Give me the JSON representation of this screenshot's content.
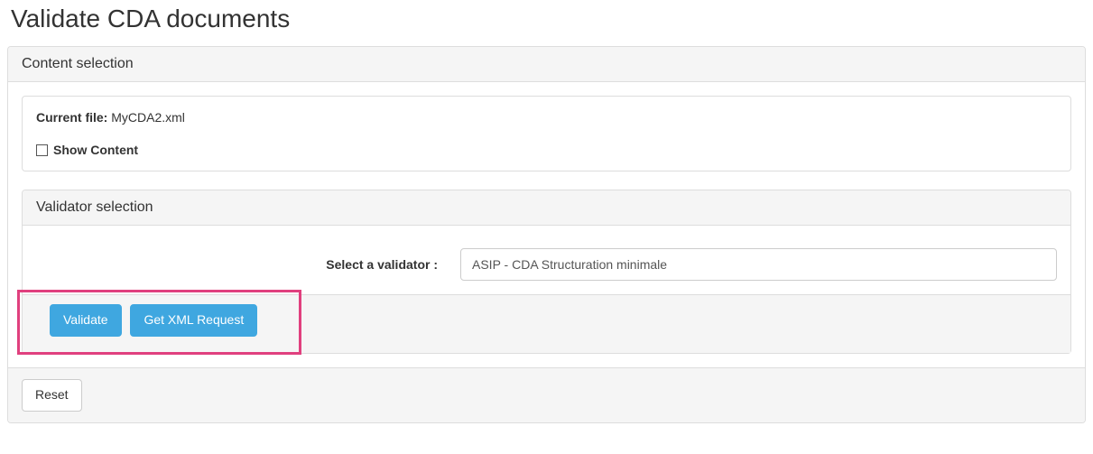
{
  "page": {
    "title": "Validate CDA documents"
  },
  "content_selection": {
    "heading": "Content selection",
    "current_file_label": "Current file:",
    "current_file_value": "MyCDA2.xml",
    "show_content_label": "Show Content",
    "show_content_checked": false
  },
  "validator_selection": {
    "heading": "Validator selection",
    "select_label": "Select a validator :",
    "selected_value": "ASIP - CDA Structuration minimale"
  },
  "actions": {
    "validate_label": "Validate",
    "get_xml_label": "Get XML Request",
    "reset_label": "Reset"
  }
}
